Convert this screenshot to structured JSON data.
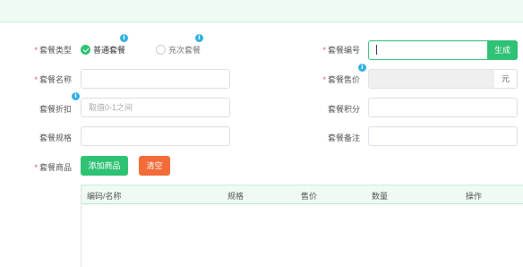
{
  "form": {
    "package_type": {
      "label": "套餐类型",
      "options": [
        {
          "label": "普通套餐",
          "checked": true
        },
        {
          "label": "充次套餐",
          "checked": false
        }
      ]
    },
    "package_no": {
      "label": "套餐编号",
      "value": "",
      "generate_label": "生成"
    },
    "package_name": {
      "label": "套餐名称",
      "value": ""
    },
    "package_price": {
      "label": "套餐售价",
      "value": "",
      "unit": "元"
    },
    "package_discount": {
      "label": "套餐折扣",
      "placeholder": "取值0-1之间"
    },
    "package_points": {
      "label": "套餐积分",
      "value": ""
    },
    "package_spec": {
      "label": "套餐规格",
      "value": ""
    },
    "package_remark": {
      "label": "套餐备注",
      "value": ""
    },
    "package_goods": {
      "label": "套餐商品",
      "add_label": "添加商品",
      "clear_label": "清空"
    }
  },
  "required_mark": "*",
  "info_glyph": "i",
  "table": {
    "columns": [
      "编码/名称",
      "规格",
      "售价",
      "数量",
      "操作"
    ],
    "rows": []
  },
  "colors": {
    "accent": "#2fc274",
    "danger": "#f26c39",
    "required": "#e5533c",
    "info": "#33b0e4",
    "banner": "#eefaf3"
  }
}
